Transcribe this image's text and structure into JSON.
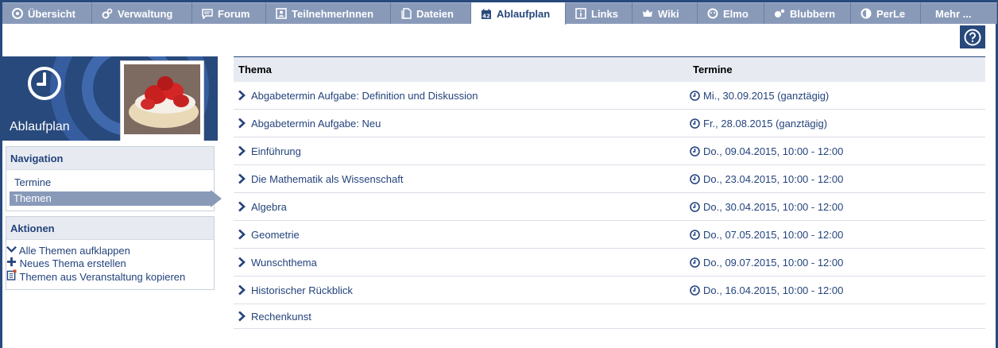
{
  "tabs": [
    {
      "label": "Übersicht",
      "icon": "info-circle-icon",
      "active": false
    },
    {
      "label": "Verwaltung",
      "icon": "gears-icon",
      "active": false
    },
    {
      "label": "Forum",
      "icon": "chat-bubble-icon",
      "active": false
    },
    {
      "label": "TeilnehmerInnen",
      "icon": "person-card-icon",
      "active": false
    },
    {
      "label": "Dateien",
      "icon": "files-icon",
      "active": false
    },
    {
      "label": "Ablaufplan",
      "icon": "calendar-icon",
      "active": true
    },
    {
      "label": "Links",
      "icon": "info-box-icon",
      "active": false
    },
    {
      "label": "Wiki",
      "icon": "wiki-icon",
      "active": false
    },
    {
      "label": "Elmo",
      "icon": "elmo-icon",
      "active": false
    },
    {
      "label": "Blubbern",
      "icon": "blubber-icon",
      "active": false
    },
    {
      "label": "PerLe",
      "icon": "perle-icon",
      "active": false
    },
    {
      "label": "Mehr ...",
      "icon": "",
      "active": false
    }
  ],
  "context": {
    "title": "Ablaufplan"
  },
  "navigation": {
    "heading": "Navigation",
    "items": [
      {
        "label": "Termine",
        "selected": false
      },
      {
        "label": "Themen",
        "selected": true
      }
    ]
  },
  "actions": {
    "heading": "Aktionen",
    "items": [
      {
        "label": "Alle Themen aufklappen",
        "icon": "chevron-down-icon"
      },
      {
        "label": "Neues Thema erstellen",
        "icon": "plus-icon"
      },
      {
        "label": "Themen aus Veranstaltung kopieren",
        "icon": "copy-document-icon"
      }
    ]
  },
  "table": {
    "headers": {
      "topic": "Thema",
      "dates": "Termine"
    },
    "rows": [
      {
        "topic": "Abgabetermin Aufgabe: Definition und Diskussion",
        "date": "Mi., 30.09.2015 (ganztägig)"
      },
      {
        "topic": "Abgabetermin Aufgabe: Neu",
        "date": "Fr., 28.08.2015 (ganztägig)"
      },
      {
        "topic": "Einführung",
        "date": "Do., 09.04.2015, 10:00 - 12:00"
      },
      {
        "topic": "Die Mathematik als Wissenschaft",
        "date": "Do., 23.04.2015, 10:00 - 12:00"
      },
      {
        "topic": "Algebra",
        "date": "Do., 30.04.2015, 10:00 - 12:00"
      },
      {
        "topic": "Geometrie",
        "date": "Do., 07.05.2015, 10:00 - 12:00"
      },
      {
        "topic": "Wunschthema",
        "date": "Do., 09.07.2015, 10:00 - 12:00"
      },
      {
        "topic": "Historischer Rückblick",
        "date": "Do., 16.04.2015, 10:00 - 12:00"
      },
      {
        "topic": "Rechenkunst",
        "date": ""
      }
    ]
  },
  "colors": {
    "brand": "#28497c",
    "tab_inactive": "#899ab9",
    "header_bg": "#e7ebf1"
  }
}
